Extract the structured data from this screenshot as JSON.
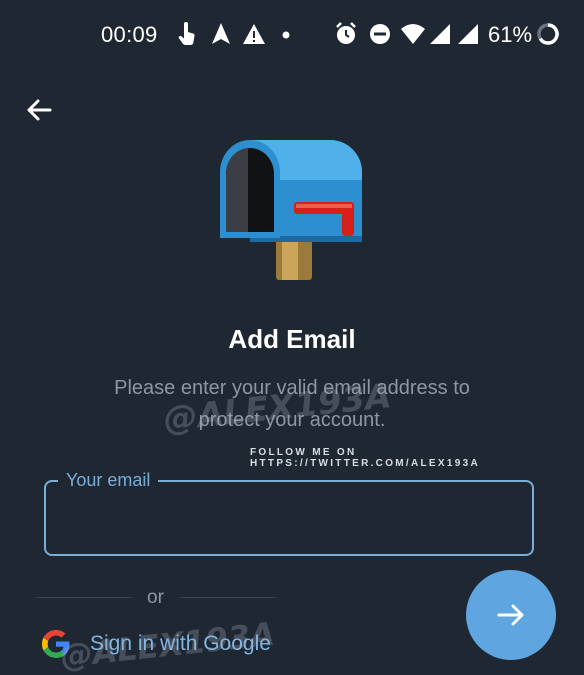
{
  "status_bar": {
    "time": "00:09",
    "battery_percent": "61%"
  },
  "page": {
    "title": "Add Email",
    "subtitle": "Please enter your valid email address to protect your account."
  },
  "watermark": {
    "handle": "@ALEX193A",
    "follow_text": "FOLLOW ME ON HTTPS://TWITTER.COM/ALEX193A"
  },
  "email_field": {
    "label": "Your email",
    "value": ""
  },
  "divider": {
    "or_text": "or"
  },
  "google_signin": {
    "label": "Sign in with Google"
  },
  "icons": {
    "back": "arrow-left-icon",
    "next": "arrow-right-icon",
    "mailbox": "mailbox-icon",
    "google": "google-icon"
  },
  "colors": {
    "background": "#1f2732",
    "accent": "#5fa5e0",
    "field_border": "#7aaed6",
    "muted_text": "#8e96a2"
  }
}
